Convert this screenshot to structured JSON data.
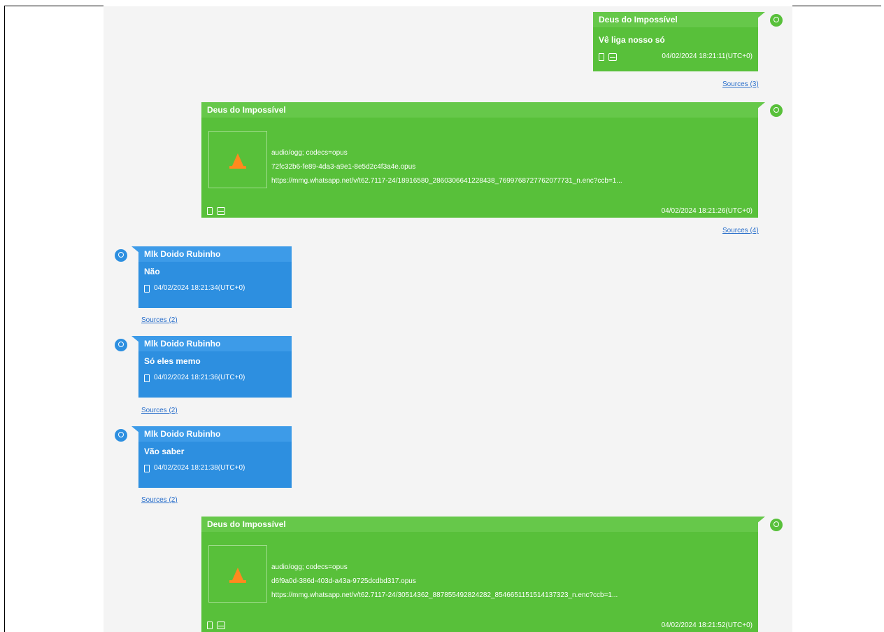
{
  "messages": [
    {
      "sender": "Deus do Impossível",
      "text": "Vê liga nosso só",
      "timestamp": "04/02/2024 18:21:11(UTC+0)",
      "sources": "Sources (3)"
    },
    {
      "sender": "Deus do Impossível",
      "media_type": "audio/ogg; codecs=opus",
      "file_name": "72fc32b6-fe89-4da3-a9e1-8e5d2c4f3a4e.opus",
      "url": "https://mmg.whatsapp.net/v/t62.7117-24/18916580_2860306641228438_7699768727762077731_n.enc?ccb=1...",
      "timestamp": "04/02/2024 18:21:26(UTC+0)",
      "sources": "Sources (4)"
    },
    {
      "sender": "Mlk Doido Rubinho",
      "text": "Não",
      "timestamp": "04/02/2024 18:21:34(UTC+0)",
      "sources": "Sources (2)"
    },
    {
      "sender": "Mlk Doido Rubinho",
      "text": "Só eles memo",
      "timestamp": "04/02/2024 18:21:36(UTC+0)",
      "sources": "Sources (2)"
    },
    {
      "sender": "Mlk Doido Rubinho",
      "text": "Vão saber",
      "timestamp": "04/02/2024 18:21:38(UTC+0)",
      "sources": "Sources (2)"
    },
    {
      "sender": "Deus do Impossível",
      "media_type": "audio/ogg; codecs=opus",
      "file_name": "d6f9a0d-386d-403d-a43a-9725dcdbd317.opus",
      "url": "https://mmg.whatsapp.net/v/t62.7117-24/30514362_887855492824282_8546651151514137323_n.enc?ccb=1...",
      "timestamp": "04/02/2024 18:21:52(UTC+0)"
    }
  ],
  "colors": {
    "outgoing": "#58c03a",
    "incoming": "#2d8fe0",
    "link": "#2a6fcb"
  },
  "icons": [
    "user-avatar-icon",
    "phone-icon",
    "message-icon",
    "media-player-cone-icon"
  ]
}
